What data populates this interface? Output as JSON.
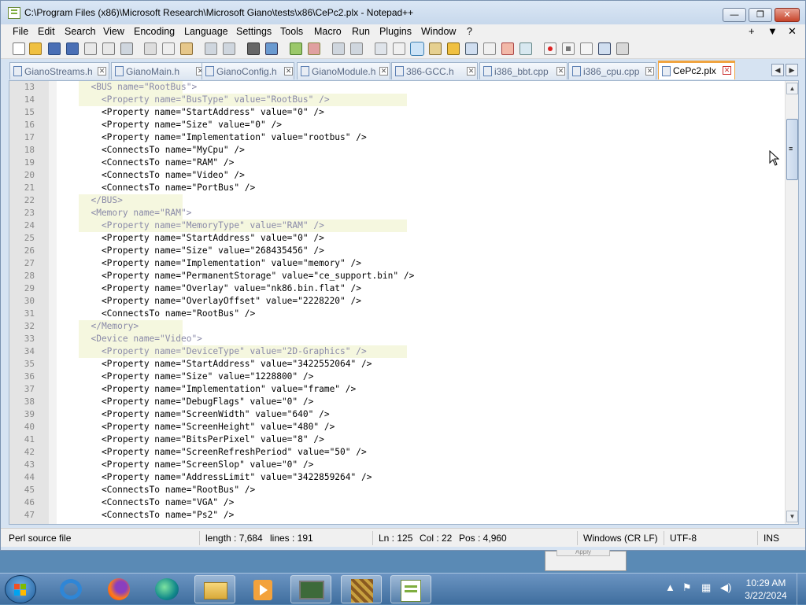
{
  "window": {
    "title": "C:\\Program Files (x86)\\Microsoft Research\\Microsoft Giano\\tests\\x86\\CePc2.plx - Notepad++",
    "min_label": "—",
    "max_label": "❐",
    "close_label": "✕"
  },
  "menu": {
    "items": [
      "File",
      "Edit",
      "Search",
      "View",
      "Encoding",
      "Language",
      "Settings",
      "Tools",
      "Macro",
      "Run",
      "Plugins",
      "Window",
      "?"
    ],
    "right": [
      "+",
      "▼",
      "✕"
    ]
  },
  "toolbar": {
    "icons": [
      "new-file-icon",
      "open-file-icon",
      "save-icon",
      "save-all-icon",
      "close-icon",
      "close-all-icon",
      "print-icon",
      "cut-icon",
      "copy-icon",
      "paste-icon",
      "undo-icon",
      "redo-icon",
      "find-icon",
      "replace-icon",
      "zoom-in-icon",
      "zoom-out-icon",
      "sync-vertical-icon",
      "sync-horizontal-icon",
      "word-wrap-icon",
      "show-all-chars-icon",
      "indent-guide-icon",
      "udl-icon",
      "doc-map-icon",
      "function-list-icon",
      "folder-workspace-icon",
      "monitoring-icon",
      "record-macro-icon",
      "stop-record-icon",
      "playback-icon",
      "run-macro-multiple-icon",
      "save-macro-icon"
    ]
  },
  "tabs": [
    {
      "label": "GianoStreams.h",
      "active": false
    },
    {
      "label": "GianoMain.h",
      "active": false
    },
    {
      "label": "GianoConfig.h",
      "active": false
    },
    {
      "label": "GianoModule.h",
      "active": false
    },
    {
      "label": "386-GCC.h",
      "active": false
    },
    {
      "label": "i386_bbt.cpp",
      "active": false
    },
    {
      "label": "i386_cpu.cpp",
      "active": false
    },
    {
      "label": "CePc2.plx",
      "active": true
    }
  ],
  "editor": {
    "lines": [
      {
        "n": "13",
        "text": "  <BUS name=\"RootBus\">",
        "hl": "hl2"
      },
      {
        "n": "14",
        "text": "    <Property name=\"BusType\" value=\"RootBus\" />",
        "hl": "hl"
      },
      {
        "n": "15",
        "text": "    <Property name=\"StartAddress\" value=\"0\" />",
        "hl": ""
      },
      {
        "n": "16",
        "text": "    <Property name=\"Size\" value=\"0\" />",
        "hl": ""
      },
      {
        "n": "17",
        "text": "    <Property name=\"Implementation\" value=\"rootbus\" />",
        "hl": ""
      },
      {
        "n": "18",
        "text": "    <ConnectsTo name=\"MyCpu\" />",
        "hl": ""
      },
      {
        "n": "19",
        "text": "    <ConnectsTo name=\"RAM\" />",
        "hl": ""
      },
      {
        "n": "20",
        "text": "    <ConnectsTo name=\"Video\" />",
        "hl": ""
      },
      {
        "n": "21",
        "text": "    <ConnectsTo name=\"PortBus\" />",
        "hl": ""
      },
      {
        "n": "22",
        "text": "  </BUS>",
        "hl": "hl2"
      },
      {
        "n": "23",
        "text": "  <Memory name=\"RAM\">",
        "hl": "hl2"
      },
      {
        "n": "24",
        "text": "    <Property name=\"MemoryType\" value=\"RAM\" />",
        "hl": "hl"
      },
      {
        "n": "25",
        "text": "    <Property name=\"StartAddress\" value=\"0\" />",
        "hl": ""
      },
      {
        "n": "26",
        "text": "    <Property name=\"Size\" value=\"268435456\" />",
        "hl": ""
      },
      {
        "n": "27",
        "text": "    <Property name=\"Implementation\" value=\"memory\" />",
        "hl": ""
      },
      {
        "n": "28",
        "text": "    <Property name=\"PermanentStorage\" value=\"ce_support.bin\" />",
        "hl": ""
      },
      {
        "n": "29",
        "text": "    <Property name=\"Overlay\" value=\"nk86.bin.flat\" />",
        "hl": ""
      },
      {
        "n": "30",
        "text": "    <Property name=\"OverlayOffset\" value=\"2228220\" />",
        "hl": ""
      },
      {
        "n": "31",
        "text": "    <ConnectsTo name=\"RootBus\" />",
        "hl": ""
      },
      {
        "n": "32",
        "text": "  </Memory>",
        "hl": "hl2"
      },
      {
        "n": "33",
        "text": "  <Device name=\"Video\">",
        "hl": "hl2"
      },
      {
        "n": "34",
        "text": "    <Property name=\"DeviceType\" value=\"2D-Graphics\" />",
        "hl": "hl"
      },
      {
        "n": "35",
        "text": "    <Property name=\"StartAddress\" value=\"3422552064\" />",
        "hl": ""
      },
      {
        "n": "36",
        "text": "    <Property name=\"Size\" value=\"1228800\" />",
        "hl": ""
      },
      {
        "n": "37",
        "text": "    <Property name=\"Implementation\" value=\"frame\" />",
        "hl": ""
      },
      {
        "n": "38",
        "text": "    <Property name=\"DebugFlags\" value=\"0\" />",
        "hl": ""
      },
      {
        "n": "39",
        "text": "    <Property name=\"ScreenWidth\" value=\"640\" />",
        "hl": ""
      },
      {
        "n": "40",
        "text": "    <Property name=\"ScreenHeight\" value=\"480\" />",
        "hl": ""
      },
      {
        "n": "41",
        "text": "    <Property name=\"BitsPerPixel\" value=\"8\" />",
        "hl": ""
      },
      {
        "n": "42",
        "text": "    <Property name=\"ScreenRefreshPeriod\" value=\"50\" />",
        "hl": ""
      },
      {
        "n": "43",
        "text": "    <Property name=\"ScreenSlop\" value=\"0\" />",
        "hl": ""
      },
      {
        "n": "44",
        "text": "    <Property name=\"AddressLimit\" value=\"3422859264\" />",
        "hl": ""
      },
      {
        "n": "45",
        "text": "    <ConnectsTo name=\"RootBus\" />",
        "hl": ""
      },
      {
        "n": "46",
        "text": "    <ConnectsTo name=\"VGA\" />",
        "hl": ""
      },
      {
        "n": "47",
        "text": "    <ConnectsTo name=\"Ps2\" />",
        "hl": ""
      }
    ]
  },
  "status": {
    "file_type": "Perl source file",
    "length": "length : 7,684",
    "lines": "lines : 191",
    "ln": "Ln : 125",
    "col": "Col : 22",
    "pos": "Pos : 4,960",
    "eol": "Windows (CR LF)",
    "encoding": "UTF-8",
    "mode": "INS"
  },
  "background_dialog": {
    "button_label": "Apply"
  },
  "taskbar": {
    "apps": [
      "internet-explorer-icon",
      "firefox-icon",
      "edge-icon",
      "file-explorer-icon",
      "media-player-icon",
      "giano-icon",
      "art-icon",
      "notepadpp-icon"
    ],
    "clock_time": "10:29 AM",
    "clock_date": "3/22/2024"
  }
}
